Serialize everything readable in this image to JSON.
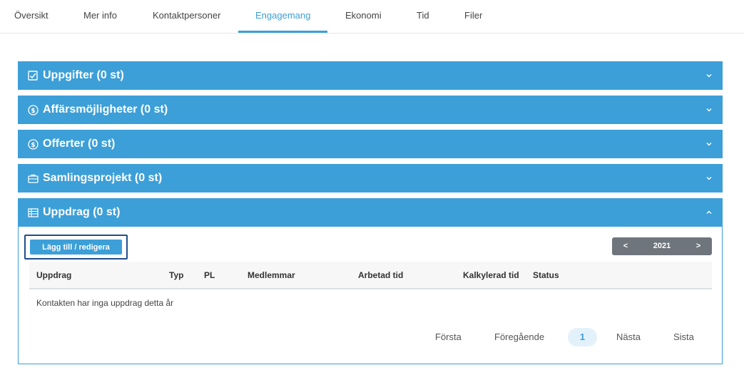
{
  "tabs": [
    {
      "label": "Översikt",
      "active": false
    },
    {
      "label": "Mer info",
      "active": false
    },
    {
      "label": "Kontaktpersoner",
      "active": false
    },
    {
      "label": "Engagemang",
      "active": true
    },
    {
      "label": "Ekonomi",
      "active": false
    },
    {
      "label": "Tid",
      "active": false
    },
    {
      "label": "Filer",
      "active": false
    }
  ],
  "panels": [
    {
      "title": "Uppgifter (0 st)",
      "icon": "checkbox-icon",
      "expanded": false
    },
    {
      "title": "Affärsmöjligheter (0 st)",
      "icon": "dollar-circle-icon",
      "expanded": false
    },
    {
      "title": "Offerter (0 st)",
      "icon": "dollar-circle-icon",
      "expanded": false
    },
    {
      "title": "Samlingsprojekt (0 st)",
      "icon": "briefcase-icon",
      "expanded": false
    },
    {
      "title": "Uppdrag (0 st)",
      "icon": "table-icon",
      "expanded": true
    }
  ],
  "uppdrag": {
    "add_button": "Lägg till / redigera",
    "year_nav": {
      "prev": "<",
      "year": "2021",
      "next": ">"
    },
    "columns": [
      "Uppdrag",
      "Typ",
      "PL",
      "Medlemmar",
      "Arbetad tid",
      "Kalkylerad tid",
      "Status"
    ],
    "empty_text": "Kontakten har inga uppdrag detta år",
    "pagination": {
      "first": "Första",
      "prev": "Föregående",
      "current": "1",
      "next": "Nästa",
      "last": "Sista"
    }
  },
  "colors": {
    "accent": "#3c9fd8",
    "year_nav_bg": "#6e757c",
    "add_focus_border": "#1f4e8c"
  }
}
